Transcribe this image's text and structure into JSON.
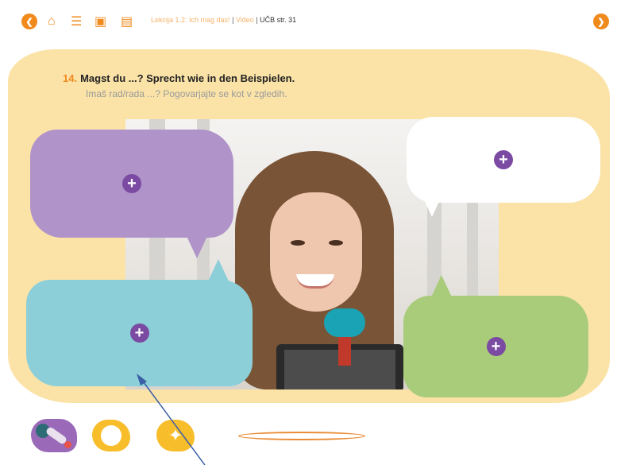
{
  "toolbar": {
    "breadcrumb_lesson": "Lekcija 1.2: Ich mag das!",
    "breadcrumb_video": "Video",
    "breadcrumb_sep": " | ",
    "breadcrumb_ucb": "UČB str. 31",
    "icons": [
      "back-arrow-icon",
      "home-icon",
      "list-icon",
      "backpack-icon",
      "book-icon",
      "forward-arrow-icon"
    ]
  },
  "task": {
    "number": "14.",
    "title": "Magst du ...? Sprecht wie in den Beispielen.",
    "subtitle": "Imaš rad/rada ...? Pogovarjajte se kot v zgledih."
  },
  "bubbles": [
    {
      "color": "#b093c9",
      "symbol": "+"
    },
    {
      "color": "#ffffff",
      "symbol": "+"
    },
    {
      "color": "#8ccfd8",
      "symbol": "+"
    },
    {
      "color": "#a8cc7a",
      "symbol": "+"
    }
  ],
  "colors": {
    "accent": "#f08a1c",
    "panel": "#fbe3a8",
    "plus": "#7b4aa2",
    "tool_yellow": "#f7bd2b",
    "tool_purple": "#9a6ab8"
  }
}
